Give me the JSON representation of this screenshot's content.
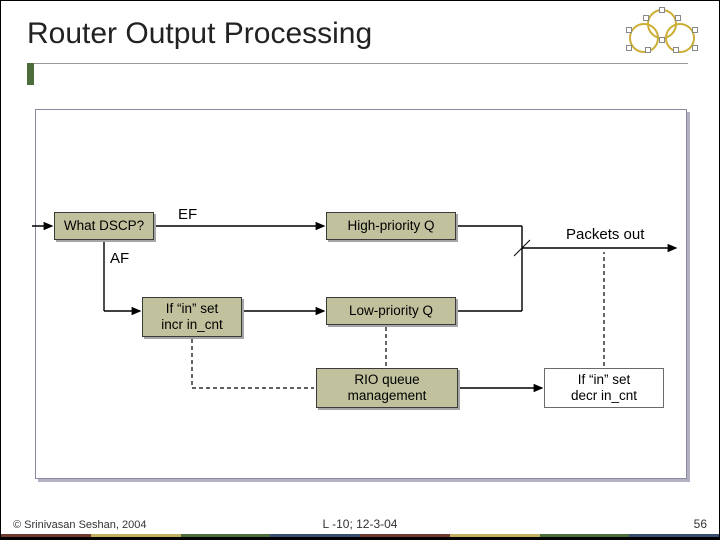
{
  "title": "Router Output Processing",
  "labels": {
    "ef": "EF",
    "af": "AF",
    "packets_out": "Packets out"
  },
  "boxes": {
    "dscp": "What DSCP?",
    "if_in_incr": "If “in” set\nincr in_cnt",
    "hiq": "High-priority Q",
    "loq": "Low-priority Q",
    "rio": "RIO queue\nmanagement",
    "if_in_decr": "If “in” set\ndecr in_cnt"
  },
  "footer": {
    "copyright": "© Srinivasan Seshan, 2004",
    "lecture": "L -10; 12-3-04",
    "page": "56"
  },
  "colors": {
    "box_fill": "#c1c29d",
    "accent": "#4c6c3b",
    "bar": [
      "#6f3b2e",
      "#c0b060",
      "#4c6c3b",
      "#384e70",
      "#6f3b2e",
      "#c0b060",
      "#4c6c3b",
      "#384e70"
    ]
  }
}
